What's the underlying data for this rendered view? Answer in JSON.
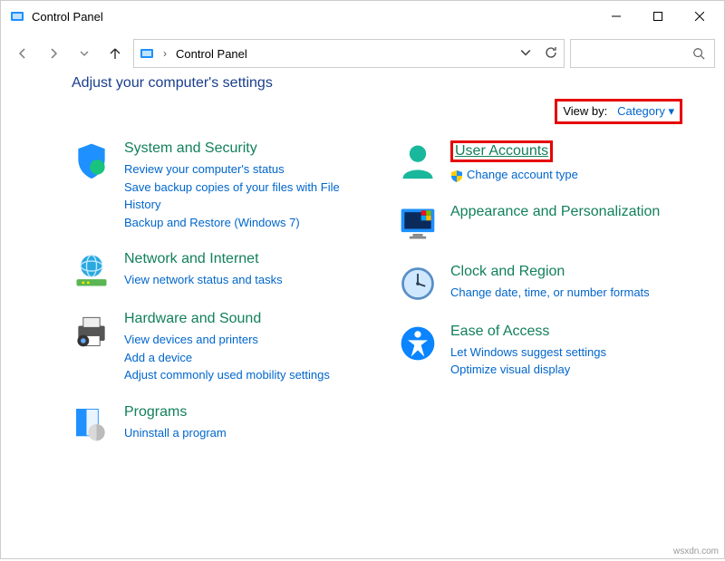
{
  "window": {
    "title": "Control Panel"
  },
  "address": {
    "crumb": "Control Panel"
  },
  "heading": "Adjust your computer's settings",
  "viewby": {
    "label": "View by:",
    "value": "Category"
  },
  "left": {
    "sys": {
      "title": "System and Security",
      "l1": "Review your computer's status",
      "l2": "Save backup copies of your files with File History",
      "l3": "Backup and Restore (Windows 7)"
    },
    "net": {
      "title": "Network and Internet",
      "l1": "View network status and tasks"
    },
    "hw": {
      "title": "Hardware and Sound",
      "l1": "View devices and printers",
      "l2": "Add a device",
      "l3": "Adjust commonly used mobility settings"
    },
    "prog": {
      "title": "Programs",
      "l1": "Uninstall a program"
    }
  },
  "right": {
    "user": {
      "title": "User Accounts",
      "l1": "Change account type"
    },
    "app": {
      "title": "Appearance and Personalization"
    },
    "clk": {
      "title": "Clock and Region",
      "l1": "Change date, time, or number formats"
    },
    "ease": {
      "title": "Ease of Access",
      "l1": "Let Windows suggest settings",
      "l2": "Optimize visual display"
    }
  },
  "credit": "wsxdn.com"
}
